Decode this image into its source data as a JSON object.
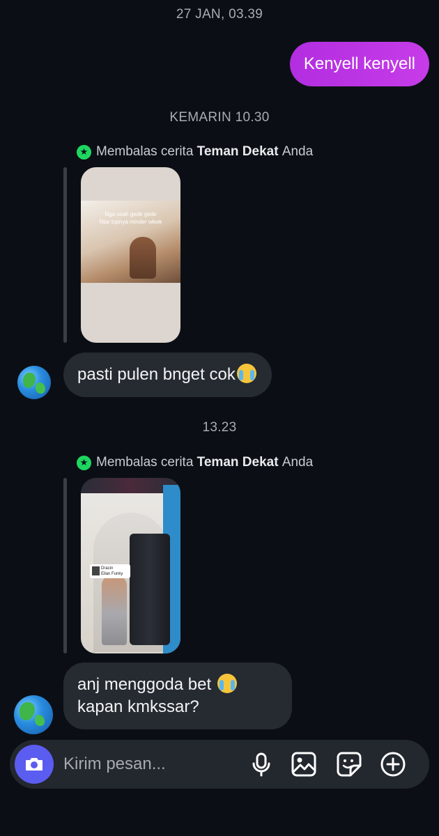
{
  "timestamps": {
    "first": "27 JAN, 03.39",
    "second": "KEMARIN 10.30",
    "third": "13.23"
  },
  "outgoing_message": "Kenyell kenyell",
  "story_reply_label": {
    "prefix": "Membalas cerita",
    "bold": "Teman Dekat",
    "suffix": "Anda"
  },
  "story1": {
    "caption_line1": "Nga usah gede gede",
    "caption_line2": "Ntar topnya minder wkwk"
  },
  "story2": {
    "music_title": "Dracin",
    "music_artist": "Ellan Funky"
  },
  "incoming_messages": [
    "pasti pulen bnget cok",
    "anj menggoda bet",
    "kapan kmkssar?"
  ],
  "composer": {
    "placeholder": "Kirim pesan...",
    "icons": [
      "camera-icon",
      "microphone-icon",
      "gallery-icon",
      "sticker-icon",
      "plus-icon"
    ]
  },
  "colors": {
    "background": "#0b0f15",
    "outgoing_bubble": "#c63ce8",
    "incoming_bubble": "#262a31",
    "camera_button": "#5b5cf0",
    "close_friends_star": "#1ed760"
  }
}
